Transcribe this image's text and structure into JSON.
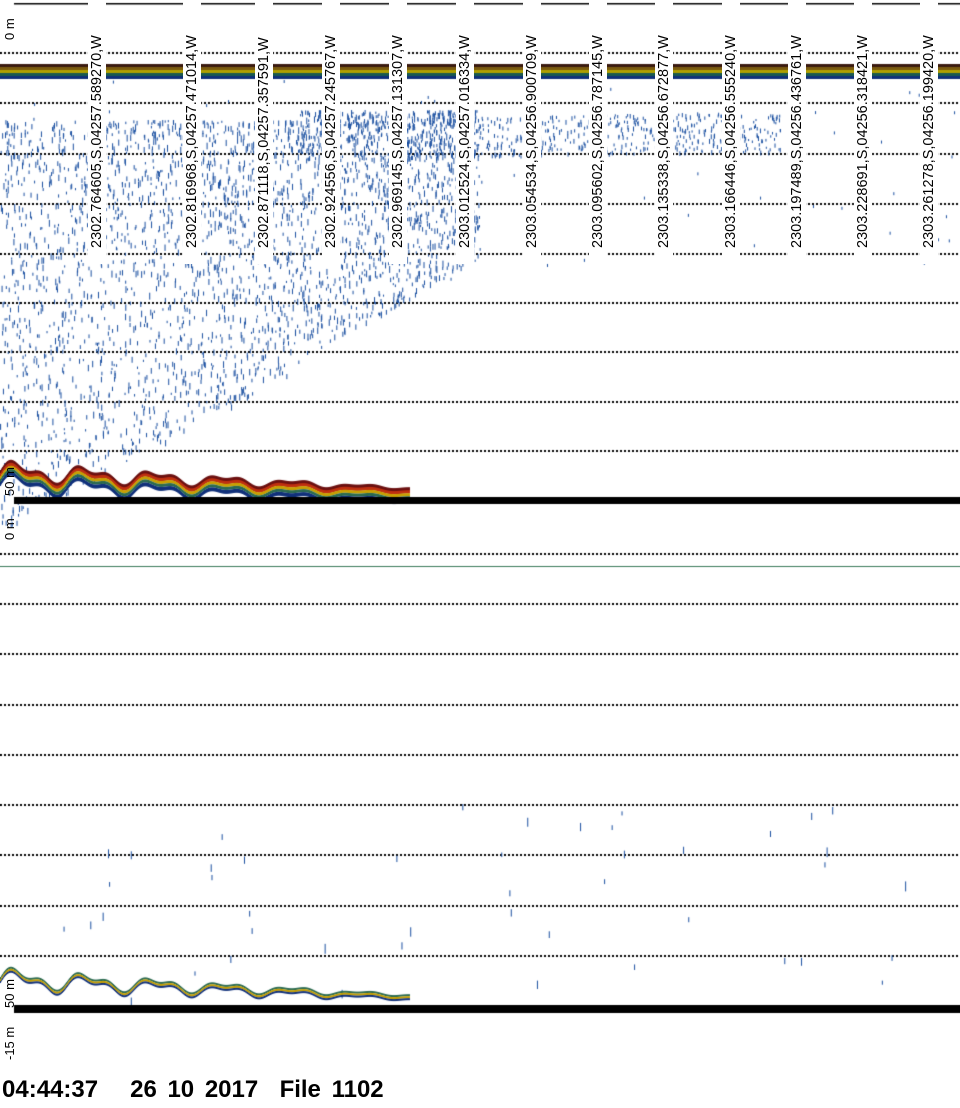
{
  "position_labels": [
    "2302.764605,S,04257.589270,W",
    "2302.816968,S,04257.471014,W",
    "2302.871118,S,04257.357591,W",
    "2302.924556,S,04257.245767,W",
    "2302.969145,S,04257.131307,W",
    "2303.012524,S,04257.016334,W",
    "2303.054534,S,04256.900709,W",
    "2303.095602,S,04256.787145,W",
    "2303.135338,S,04256.672877,W",
    "2303.166446,S,04256.555240,W",
    "2303.197489,S,04256.436761,W",
    "2303.228691,S,04256.318421,W",
    "2303.261278,S,04256.199420,W"
  ],
  "axis": {
    "top_panel_top": "0 m",
    "top_panel_bottom": "50 m",
    "bottom_panel_top": "0 m",
    "bottom_panel_bottom_a": "50 m",
    "bottom_panel_bottom_b": "-15 m"
  },
  "footer": {
    "time": "04:44:37",
    "date": "26 10 2017",
    "file": "File 1102"
  },
  "colors": {
    "speckle": "#1a4fa0",
    "seabed_strong": "#6b1010",
    "seabed_mid": "#c8a000",
    "seabed_weak": "#2a6a50",
    "bottom_line": "#000000",
    "divider": "#3a7a5a"
  }
}
